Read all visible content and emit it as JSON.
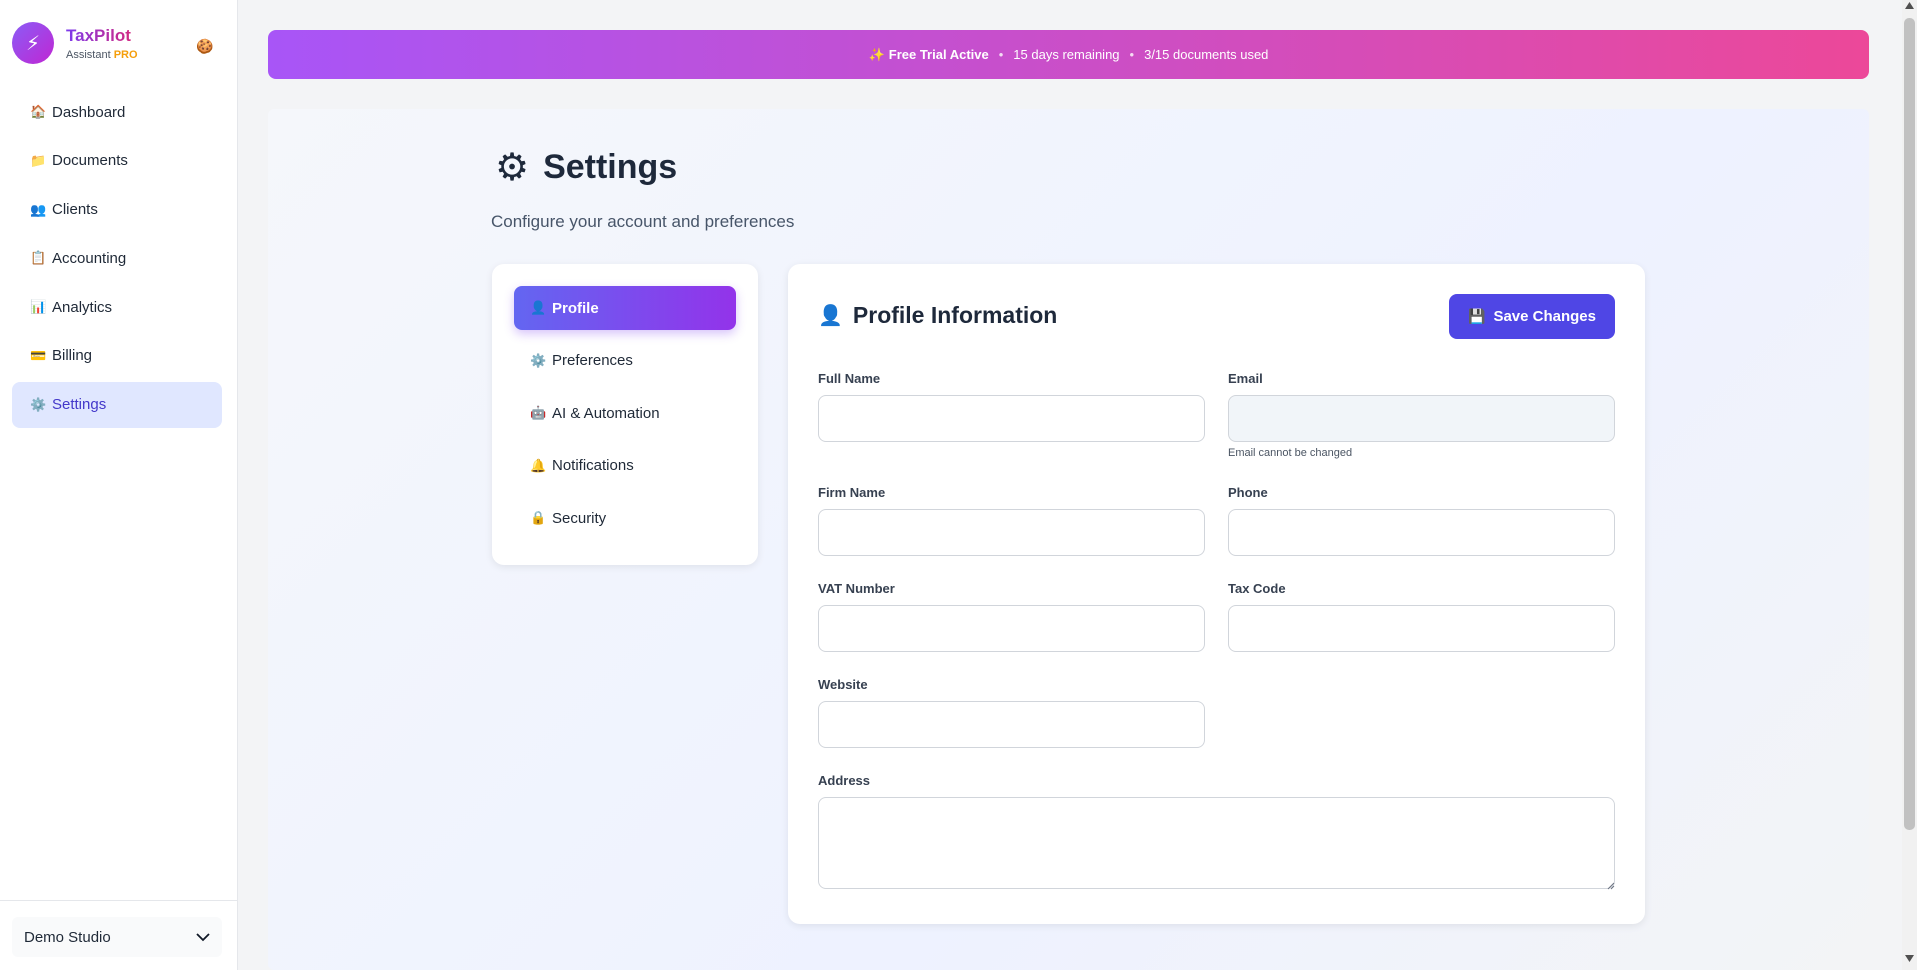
{
  "brand": {
    "name": "TaxPilot",
    "sub": "Assistant",
    "tier": "PRO",
    "logo_glyph": "⚡",
    "badge_glyph": "🍪"
  },
  "sidebar": {
    "items": [
      {
        "icon": "🏠",
        "label": "Dashboard"
      },
      {
        "icon": "📁",
        "label": "Documents"
      },
      {
        "icon": "👥",
        "label": "Clients"
      },
      {
        "icon": "📋",
        "label": "Accounting"
      },
      {
        "icon": "📊",
        "label": "Analytics"
      },
      {
        "icon": "💳",
        "label": "Billing"
      },
      {
        "icon": "⚙️",
        "label": "Settings"
      }
    ],
    "active": "Settings",
    "workspace": "Demo Studio"
  },
  "banner": {
    "icon": "✨",
    "title": "Free Trial Active",
    "days": "15 days remaining",
    "docs": "3/15 documents used",
    "separator": "•"
  },
  "page": {
    "icon": "⚙",
    "title": "Settings",
    "subtitle": "Configure your account and preferences"
  },
  "tabs": [
    {
      "icon": "👤",
      "label": "Profile"
    },
    {
      "icon": "⚙️",
      "label": "Preferences"
    },
    {
      "icon": "🤖",
      "label": "AI & Automation"
    },
    {
      "icon": "🔔",
      "label": "Notifications"
    },
    {
      "icon": "🔒",
      "label": "Security"
    }
  ],
  "form": {
    "icon": "👤",
    "title": "Profile Information",
    "save_icon": "💾",
    "save_label": "Save Changes",
    "fields": {
      "full_name": {
        "label": "Full Name",
        "value": ""
      },
      "email": {
        "label": "Email",
        "value": "",
        "hint": "Email cannot be changed"
      },
      "firm_name": {
        "label": "Firm Name",
        "value": ""
      },
      "phone": {
        "label": "Phone",
        "value": ""
      },
      "vat_number": {
        "label": "VAT Number",
        "value": ""
      },
      "tax_code": {
        "label": "Tax Code",
        "value": ""
      },
      "website": {
        "label": "Website",
        "value": ""
      },
      "address": {
        "label": "Address",
        "value": ""
      }
    }
  },
  "colors": {
    "accent": "#4f46e5",
    "banner_start": "#a855f7",
    "banner_end": "#ec4899",
    "active_nav_bg": "#e0e7ff"
  }
}
